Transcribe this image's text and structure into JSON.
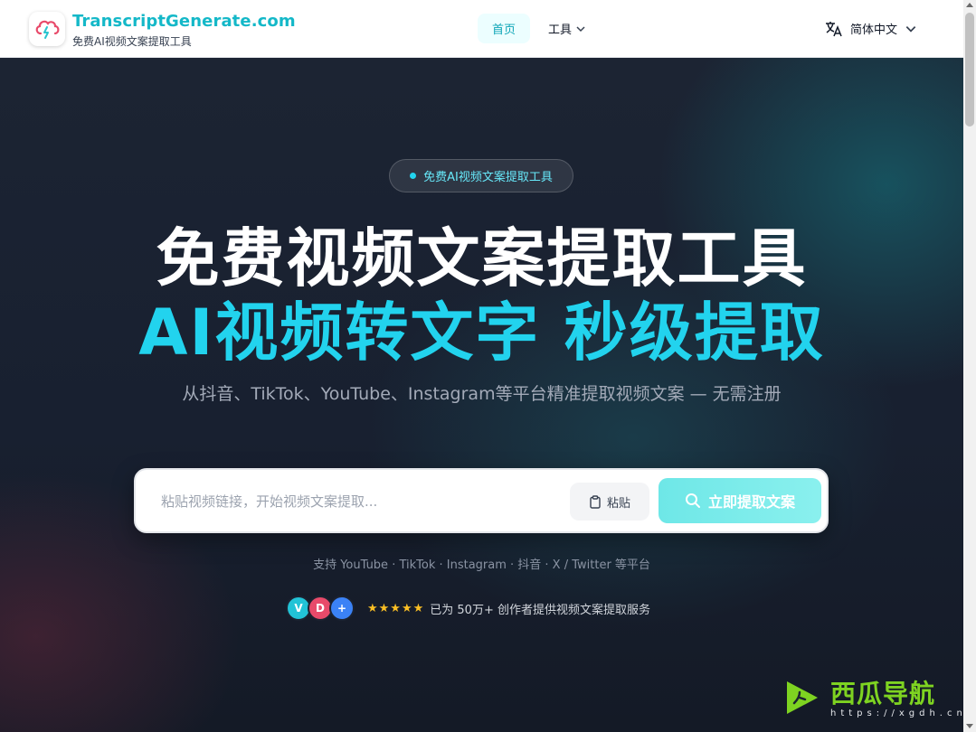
{
  "header": {
    "brand_name": "TranscriptGenerate.com",
    "brand_sub": "免费AI视频文案提取工具",
    "nav_home": "首页",
    "nav_tools": "工具",
    "language": "简体中文",
    "logo_icon": "cloud-lightning-icon"
  },
  "hero": {
    "badge": "免费AI视频文案提取工具",
    "title_line1": "免费视频文案提取工具",
    "title_line2": "AI视频转文字 秒级提取",
    "subtitle": "从抖音、TikTok、YouTube、Instagram等平台精准提取视频文案 — 无需注册",
    "search_placeholder": "粘贴视频链接，开始视频文案提取...",
    "paste_label": "粘贴",
    "extract_label": "立即提取文案",
    "platforms": "支持 YouTube · TikTok · Instagram · 抖音 · X / Twitter 等平台",
    "avatars": [
      {
        "letter": "V",
        "color": "#22c3d6"
      },
      {
        "letter": "D",
        "color": "#e84a6a"
      },
      {
        "letter": "+",
        "color": "#3b82f6"
      }
    ],
    "stars": "★★★★★",
    "social_proof": "已为 50万+ 创作者提供视频文案提取服务"
  },
  "watermark": {
    "text": "西瓜导航",
    "url": "https://xgdh.cn"
  },
  "colors": {
    "accent": "#22d3ee",
    "brand": "#14b8c8",
    "extract_button": "#7eece9"
  }
}
